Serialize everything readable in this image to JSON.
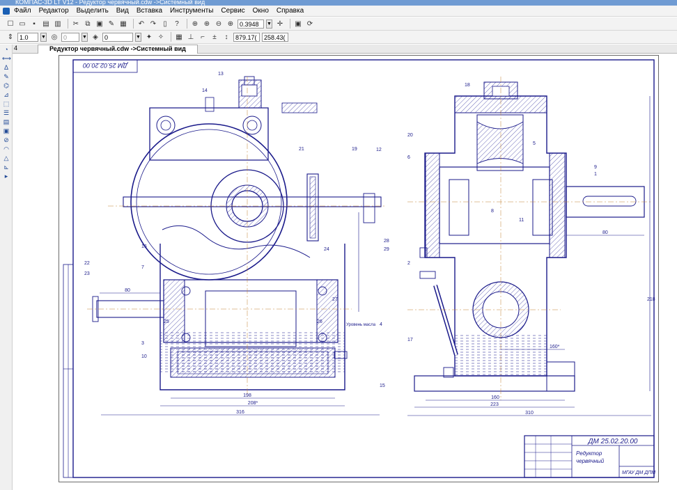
{
  "window": {
    "title": "КОМПАС-3D LT V12 - Редуктор червячный.cdw ->Системный вид"
  },
  "menu": [
    "Файл",
    "Редактор",
    "Выделить",
    "Вид",
    "Вставка",
    "Инструменты",
    "Сервис",
    "Окно",
    "Справка"
  ],
  "toolbar": {
    "zoom_value": "0.3948",
    "line_scale": "1.0",
    "layer_value": "0",
    "coord_x": "879.17(",
    "coord_y": "258.43("
  },
  "tabs": {
    "number": "4",
    "active_tab": "Редуктор червячный.cdw ->Системный вид"
  },
  "drawing": {
    "stamp_code_top": "ДМ 25.02.20.00",
    "stamp_code": "ДМ 25.02.20.00",
    "stamp_name_1": "Редуктор",
    "stamp_name_2": "червячный",
    "stamp_org": "МГАУ ДМ ДПМ",
    "dim_front_inner": "198",
    "dim_front_mid": "208*",
    "dim_front_total": "316",
    "dim_side_inner": "160",
    "dim_side_mid": "223",
    "dim_side_total": "310",
    "dim_shaft_left": "80",
    "dim_shaft_right": "80",
    "dim_height": "218",
    "dim_center": "160*",
    "oil_label": "Уровень масла",
    "part_labels": [
      "14",
      "13",
      "12",
      "19",
      "21",
      "16",
      "7",
      "3",
      "10",
      "15",
      "18",
      "20",
      "5",
      "6",
      "9",
      "4",
      "1",
      "11",
      "17",
      "2",
      "8",
      "24",
      "25",
      "26",
      "27",
      "28",
      "29",
      "22",
      "23"
    ]
  }
}
